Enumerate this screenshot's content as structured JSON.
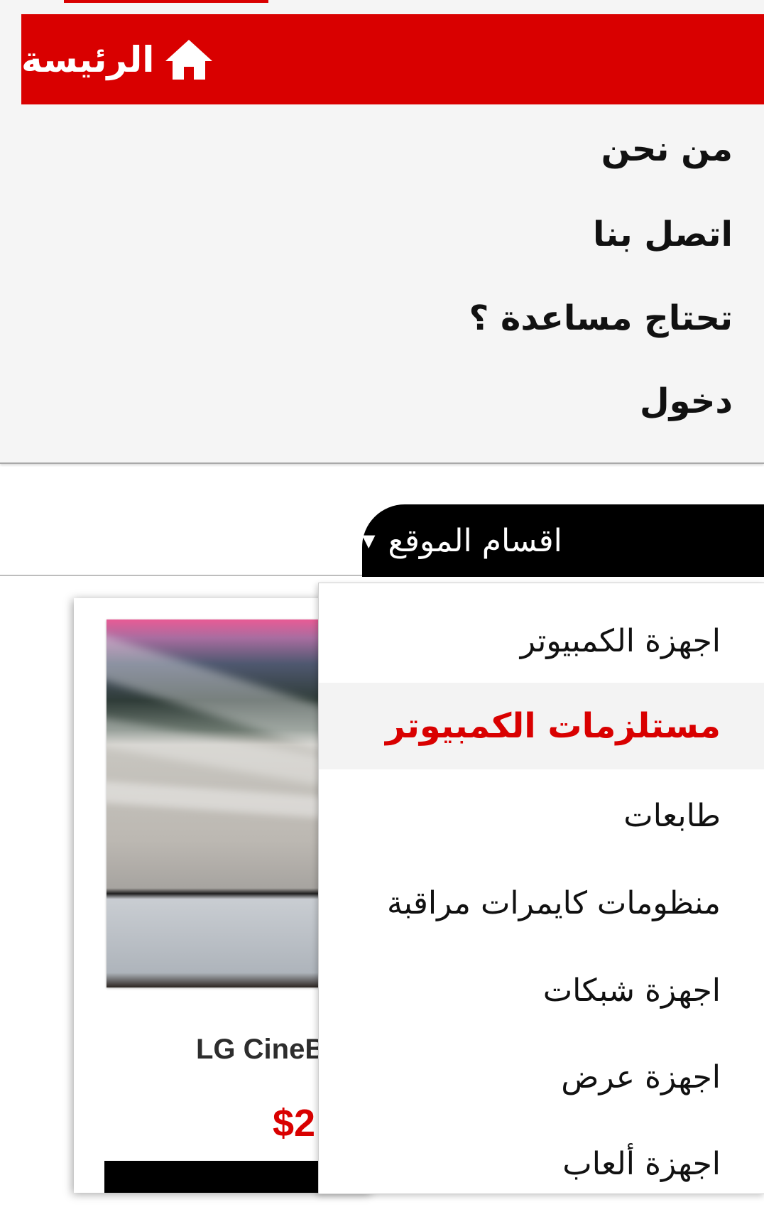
{
  "nav": {
    "home_label": "الرئيسة",
    "items": [
      {
        "label": "من نحن"
      },
      {
        "label": "اتصل بنا"
      },
      {
        "label": "تحتاج مساعدة ؟"
      },
      {
        "label": "دخول"
      }
    ]
  },
  "categories": {
    "tab_label": "اقسام الموقع",
    "caret": "▼",
    "items": [
      {
        "label": "اجهزة الكمبيوتر"
      },
      {
        "label": "مستلزمات الكمبيوتر"
      },
      {
        "label": "طابعات"
      },
      {
        "label": "منظومات كايمرات مراقبة"
      },
      {
        "label": "اجهزة شبكات"
      },
      {
        "label": "اجهزة عرض"
      },
      {
        "label": "اجهزة ألعاب"
      }
    ]
  },
  "product": {
    "title": "LG CineB",
    "price": "$2"
  },
  "colors": {
    "accent": "#d90000",
    "tab_bg": "#000000",
    "menu_bg": "#f5f5f5"
  }
}
